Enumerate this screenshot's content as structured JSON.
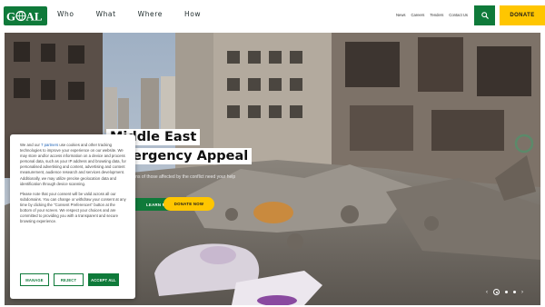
{
  "header": {
    "logo_text": "GOAL",
    "main_nav": [
      "Who",
      "What",
      "Where",
      "How"
    ],
    "util_nav": [
      "News",
      "Careers",
      "Tenders",
      "Contact Us"
    ],
    "search_icon": "search-icon",
    "donate_label": "DONATE"
  },
  "hero": {
    "title_line1": "Middle East",
    "title_line2": "Emergency Appeal",
    "subtitle": "...ns of those affected by the conflict need your help",
    "learn_more_label": "LEARN MORE",
    "donate_now_label": "DONATE NOW",
    "slider_prev_icon": "chevron-left-icon",
    "slider_pause_icon": "pause-icon",
    "slider_next_icon": "chevron-right-icon"
  },
  "cookie_banner": {
    "text_before_link": "We and our ",
    "link_text": "7 partners",
    "text_after_link": " use cookies and other tracking technologies to improve your experience on our website. We may store and/or access information on a device and process personal data, such as your IP address and browsing data, for personalised advertising and content, advertising and content measurement, audience research and services development. Additionally, we may utilize precise geolocation data and identification through device scanning.",
    "paragraph2": "Please note that your consent will be valid across all our subdomains. You can change or withdraw your consent at any time by clicking the \"Consent Preferences\" button at the bottom of your screen. We respect your choices and are committed to providing you with a transparent and secure browsing experience.",
    "manage_label": "MANAGE",
    "reject_label": "REJECT",
    "accept_label": "ACCEPT ALL"
  },
  "colors": {
    "brand_green": "#0f7a3a",
    "accent_yellow": "#ffc600"
  }
}
